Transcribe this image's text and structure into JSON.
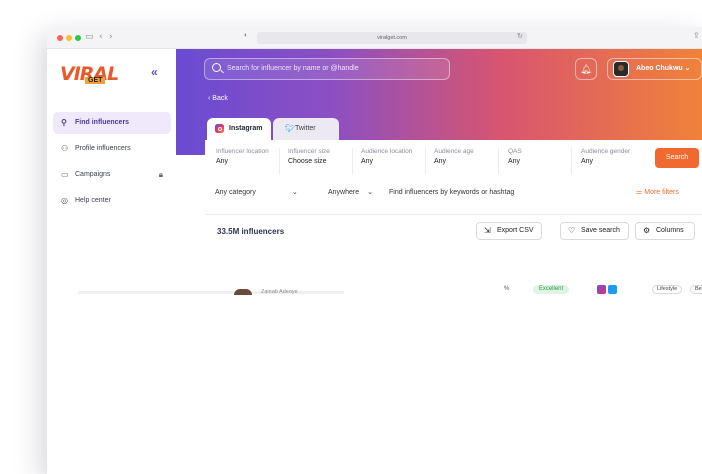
{
  "browser": {
    "url": "viralget.com",
    "nav_back": "‹",
    "nav_fwd": "›"
  },
  "brand": {
    "logo_text": "VIRAL",
    "logo_sub": "GET",
    "collapse_label": "«"
  },
  "header": {
    "search_placeholder": "Search for influencer by name or @handle",
    "user_name": "Abeo Chukwu",
    "back_label": "Back"
  },
  "sidebar": {
    "items": [
      {
        "label": "Find influencers",
        "icon": "user-search-icon",
        "active": true
      },
      {
        "label": "Profile influencers",
        "icon": "users-icon",
        "active": false
      },
      {
        "label": "Campaigns",
        "icon": "folder-icon",
        "active": false,
        "locked": true
      },
      {
        "label": "Help center",
        "icon": "help-circle-icon",
        "active": false
      }
    ]
  },
  "tabs": [
    {
      "label": "Instagram",
      "icon": "instagram-icon",
      "active": true
    },
    {
      "label": "Twitter",
      "icon": "twitter-icon",
      "active": false
    }
  ],
  "filters": [
    {
      "label": "Influencer location",
      "value": "Any"
    },
    {
      "label": "Influencer size",
      "value": "Choose size"
    },
    {
      "label": "Audience location",
      "value": "Any"
    },
    {
      "label": "Audience age",
      "value": "Any"
    },
    {
      "label": "QAS",
      "value": "Any"
    },
    {
      "label": "Audience gender",
      "value": "Any"
    }
  ],
  "search_button": "Search",
  "secondary": {
    "category": "Any category",
    "scope": "Anywhere",
    "keywords_placeholder": "Find influencers by keywords or hashtag",
    "more_filters": "More filters"
  },
  "results": {
    "count": "33.5M influencers",
    "export": "Export CSV",
    "save": "Save search",
    "columns": "Columns"
  },
  "row_preview": {
    "name": "Zainab Adeoye",
    "percent": "%",
    "quality": "Excellent",
    "tag1": "Lifestyle",
    "tag2": "Be"
  },
  "colors": {
    "accent_orange": "#f1692f",
    "accent_purple": "#6a4bd2",
    "gradient": [
      "#6a4bd2",
      "#8d4fc2",
      "#d8556f",
      "#f0823a"
    ]
  }
}
